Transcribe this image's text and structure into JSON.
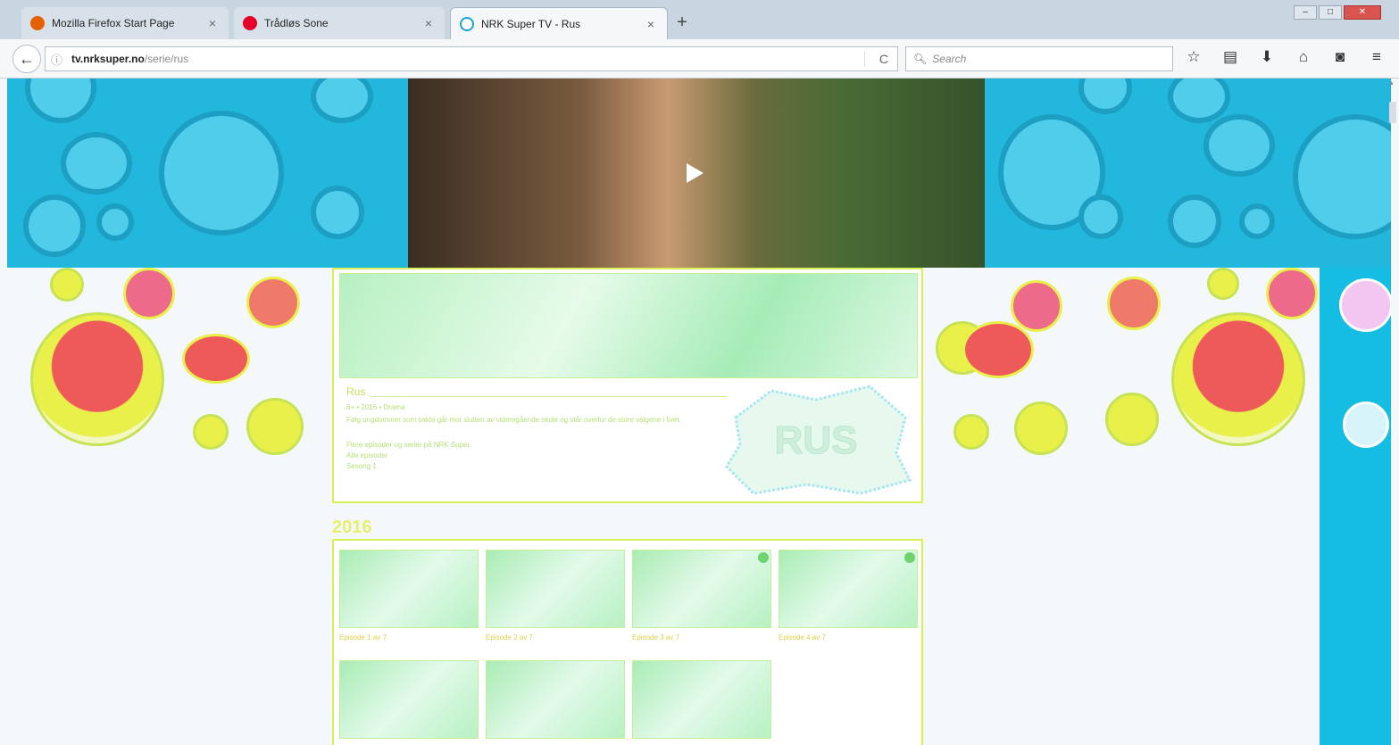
{
  "browser": {
    "tabs": [
      {
        "title": "Mozilla Firefox Start Page",
        "close": "×",
        "favicon_color": "#e66000",
        "active": false
      },
      {
        "title": "Trådløs Sone",
        "close": "×",
        "favicon_color": "#e4002b",
        "active": false
      },
      {
        "title": "NRK Super TV - Rus",
        "close": "×",
        "favicon_color": "#1aa3d6",
        "active": true
      }
    ],
    "new_tab": "+",
    "window_controls": {
      "minimize": "–",
      "maximize": "□",
      "close": "✕"
    },
    "back": "←",
    "url_host": "tv.nrksuper.no",
    "url_path": "/serie/rus",
    "reload": "C",
    "search_placeholder": "Search",
    "search_icon": "search-icon",
    "toolbar_icons": [
      "star-icon",
      "clipboard-icon",
      "download-icon",
      "home-icon",
      "pocket-icon",
      "menu-icon"
    ],
    "toolbar_glyphs": [
      "☆",
      "▤",
      "⬇",
      "⌂",
      "◙",
      "≡"
    ]
  },
  "page": {
    "series_title": "Rus",
    "meta_lines": [
      "6+  •  2016  •  Drama",
      "Følg ungdommer som sakte går mot slutten av videregående skole og står overfor de store valgene i livet.",
      "Flere episoder og serier på NRK Super.",
      "Alle episoder",
      "Sesong 1"
    ],
    "logo_text": "RUS",
    "year": "2016",
    "episodes": [
      {
        "label": "Episode 1 av 7",
        "badge": false
      },
      {
        "label": "Episode 2 av 7",
        "badge": false
      },
      {
        "label": "Episode 3 av 7",
        "badge": true
      },
      {
        "label": "Episode 4 av 7",
        "badge": true
      },
      {
        "label": "",
        "badge": false
      },
      {
        "label": "",
        "badge": false
      },
      {
        "label": "",
        "badge": false
      }
    ],
    "colors": {
      "hero_blue": "#22b8dd",
      "accent_yellow": "#d9ef56",
      "accent_green": "#b7f0c1",
      "sun_red": "#ee5a5a",
      "sun_yellow": "#e9f04a"
    }
  }
}
